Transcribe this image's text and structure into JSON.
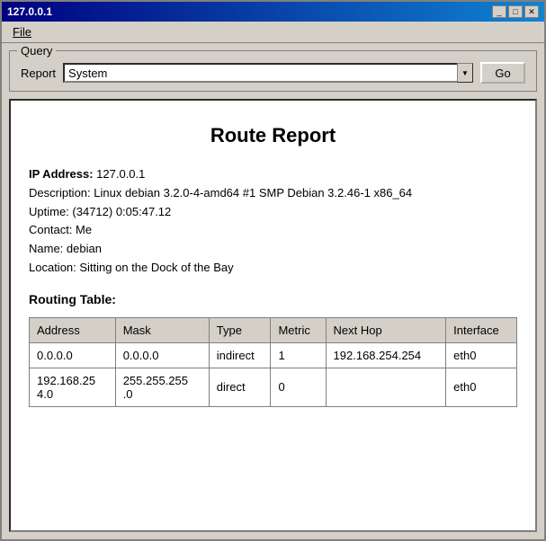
{
  "window": {
    "title": "127.0.0.1",
    "minimize_label": "_",
    "maximize_label": "□",
    "close_label": "✕"
  },
  "menu": {
    "file_label": "File"
  },
  "query": {
    "legend": "Query",
    "report_label": "Report",
    "report_value": "System",
    "report_options": [
      "System"
    ],
    "go_label": "Go"
  },
  "report": {
    "title": "Route Report",
    "ip_label": "IP Address:",
    "ip_value": "127.0.0.1",
    "description": "Description: Linux debian 3.2.0-4-amd64 #1 SMP Debian 3.2.46-1 x86_64",
    "uptime": "Uptime: (34712) 0:05:47.12",
    "contact": "Contact: Me",
    "name": "Name: debian",
    "location": "Location: Sitting on the Dock of the Bay",
    "routing_heading": "Routing Table:",
    "table": {
      "headers": [
        "Address",
        "Mask",
        "Type",
        "Metric",
        "Next Hop",
        "Interface"
      ],
      "rows": [
        {
          "address": "0.0.0.0",
          "mask": "0.0.0.0",
          "type": "indirect",
          "metric": "1",
          "nexthop": "192.168.254.254",
          "interface": "eth0"
        },
        {
          "address": "192.168.25\n4.0",
          "mask": "255.255.255\n.0",
          "type": "direct",
          "metric": "0",
          "nexthop": "",
          "interface": "eth0"
        }
      ]
    }
  }
}
